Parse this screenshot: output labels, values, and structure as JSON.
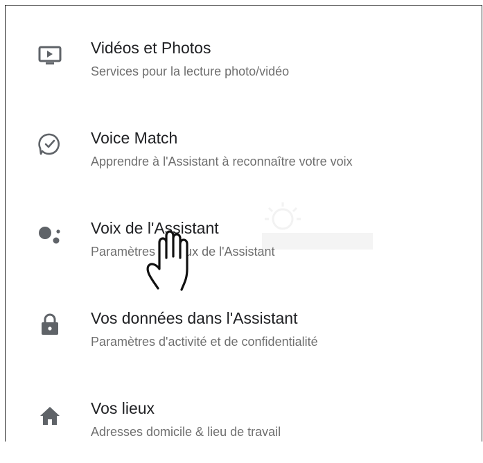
{
  "settings": {
    "items": [
      {
        "icon": "tv-play-icon",
        "title": "Vidéos et Photos",
        "subtitle": "Services pour la lecture photo/vidéo"
      },
      {
        "icon": "voice-match-icon",
        "title": "Voice Match",
        "subtitle": "Apprendre à l'Assistant à reconnaître votre voix"
      },
      {
        "icon": "assistant-dots-icon",
        "title": "Voix de l'Assistant",
        "subtitle": "Paramètres vocaux de l'Assistant"
      },
      {
        "icon": "lock-icon",
        "title": "Vos données dans l'Assistant",
        "subtitle": "Paramètres d'activité et de confidentialité"
      },
      {
        "icon": "home-icon",
        "title": "Vos lieux",
        "subtitle": "Adresses domicile & lieu de travail"
      }
    ]
  },
  "colors": {
    "icon": "#5f6368",
    "title": "#202124",
    "subtitle": "#6f6f6f"
  }
}
